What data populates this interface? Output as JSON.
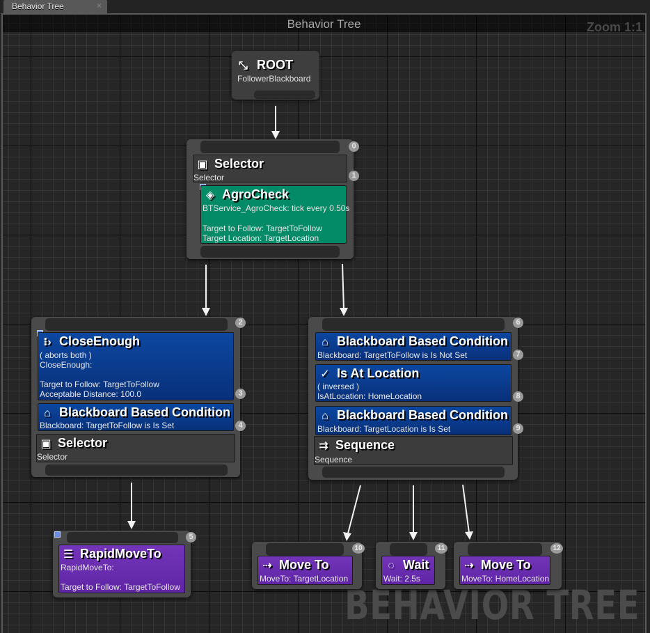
{
  "tab": {
    "label": "Behavior Tree",
    "close_icon": "×"
  },
  "graph": {
    "title": "Behavior Tree",
    "zoom": "Zoom 1:1",
    "watermark": "BEHAVIOR TREE"
  },
  "colors": {
    "composite": "#3c3c3c",
    "decorator": "#0a3c8c",
    "service": "#038a67",
    "task": "#6a2bb0"
  },
  "root": {
    "title": "ROOT",
    "blackboard": "FollowerBlackboard",
    "icon": "root-icon"
  },
  "selector_main": {
    "index": "0",
    "composite": {
      "index": "1",
      "title": "Selector",
      "subtitle": "Selector",
      "icon": "selector-icon"
    },
    "service": {
      "title": "AgroCheck",
      "icon": "service-icon",
      "lines": [
        "BTService_AgroCheck: tick every 0.50s",
        "",
        "Target to Follow: TargetToFollow",
        "Target Location: TargetLocation"
      ]
    }
  },
  "selector_left": {
    "index": "2",
    "decorators": [
      {
        "index": "3",
        "title": "CloseEnough",
        "icon": "decorator-icon",
        "lines": [
          "( aborts both )",
          "CloseEnough:",
          "",
          "Target to Follow: TargetToFollow",
          "Acceptable Distance: 100.0"
        ]
      },
      {
        "index": "4",
        "title": "Blackboard Based Condition",
        "icon": "blackboard-icon",
        "lines": [
          "Blackboard: TargetToFollow is Is Set"
        ]
      }
    ],
    "composite": {
      "title": "Selector",
      "subtitle": "Selector",
      "icon": "selector-icon"
    }
  },
  "sequence_right": {
    "index": "6",
    "decorators": [
      {
        "index": "7",
        "title": "Blackboard Based Condition",
        "icon": "blackboard-icon",
        "lines": [
          "Blackboard: TargetToFollow is Is Not Set"
        ]
      },
      {
        "index": "8",
        "title": "Is At Location",
        "icon": "location-icon",
        "lines": [
          "( inversed )",
          "IsAtLocation: HomeLocation"
        ]
      },
      {
        "index": "9",
        "title": "Blackboard Based Condition",
        "icon": "blackboard-icon",
        "lines": [
          "Blackboard: TargetLocation is Is Set"
        ]
      }
    ],
    "composite": {
      "title": "Sequence",
      "subtitle": "Sequence",
      "icon": "sequence-icon"
    }
  },
  "tasks": [
    {
      "index": "5",
      "title": "RapidMoveTo",
      "icon": "rapid-move-icon",
      "lines": [
        "RapidMoveTo:",
        "",
        "Target to Follow: TargetToFollow"
      ]
    },
    {
      "index": "10",
      "title": "Move To",
      "icon": "move-to-icon",
      "lines": [
        "MoveTo: TargetLocation"
      ]
    },
    {
      "index": "11",
      "title": "Wait",
      "icon": "wait-icon",
      "lines": [
        "Wait: 2.5s"
      ]
    },
    {
      "index": "12",
      "title": "Move To",
      "icon": "move-to-icon",
      "lines": [
        "MoveTo: HomeLocation"
      ]
    }
  ]
}
